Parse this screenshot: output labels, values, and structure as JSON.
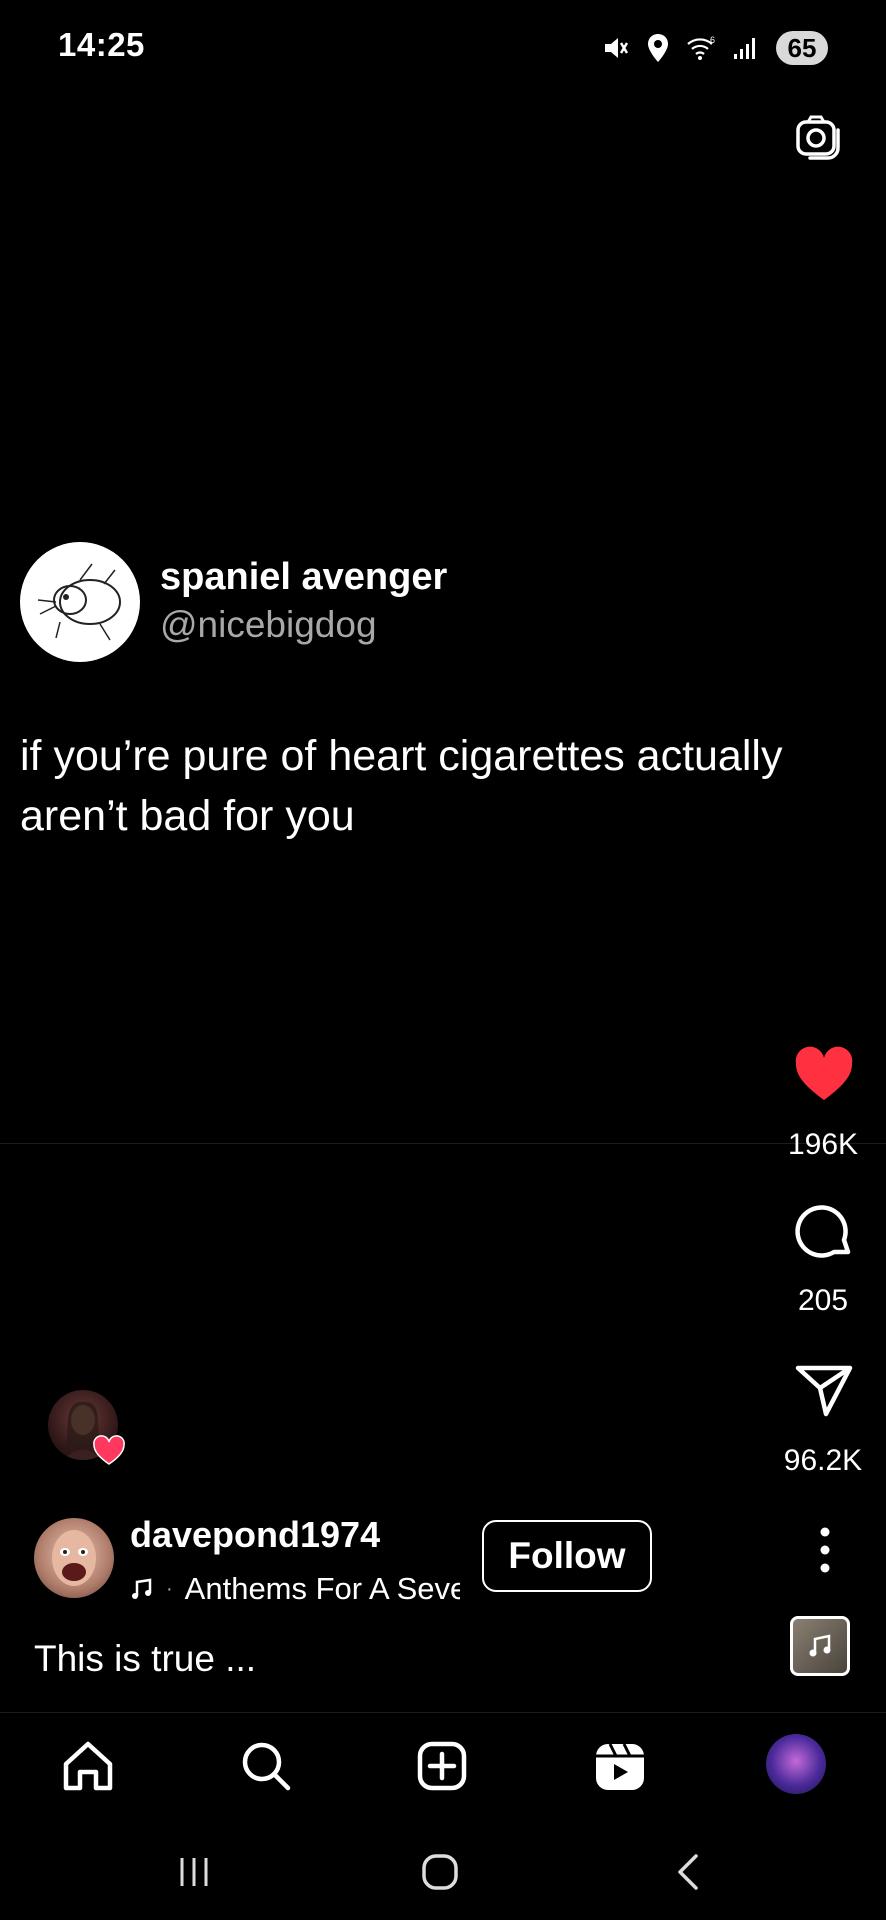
{
  "status_bar": {
    "time": "14:25",
    "battery": "65",
    "icons": [
      "mute-icon",
      "location-icon",
      "wifi-icon",
      "signal-icon"
    ]
  },
  "header": {
    "camera_icon": "camera-icon"
  },
  "tweet": {
    "name": "spaniel avenger",
    "handle": "@nicebigdog",
    "text": "if you’re pure of heart cigarettes actually aren’t bad for you"
  },
  "actions": {
    "like_count": "196K",
    "comment_count": "205",
    "share_count": "96.2K",
    "like_color": "#ff3040"
  },
  "post": {
    "author": "davepond1974",
    "audio": "Anthems For A Seventeen Year-Old Girl",
    "follow_label": "Follow",
    "caption": "This is true ..."
  },
  "bottom_nav": {
    "items": [
      "home-icon",
      "search-icon",
      "create-icon",
      "reels-icon",
      "profile-avatar"
    ]
  },
  "system_nav": {
    "items": [
      "recents-icon",
      "home-button-icon",
      "back-icon"
    ]
  }
}
